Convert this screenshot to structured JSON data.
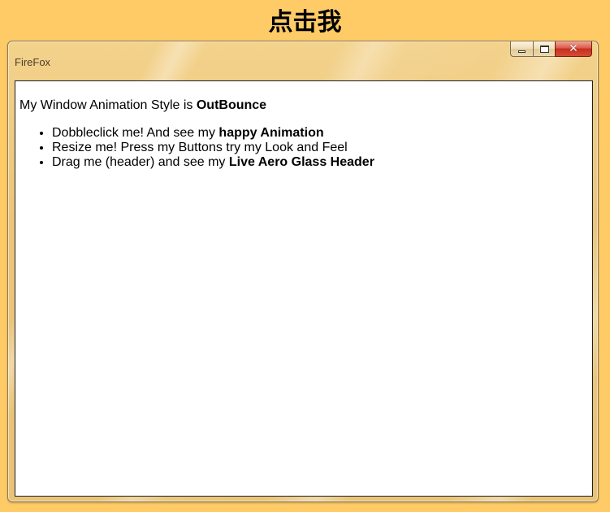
{
  "page": {
    "heading": "点击我"
  },
  "window": {
    "title": "FireFox",
    "controls": {
      "minimize": "minimize-icon",
      "maximize": "maximize-icon",
      "close": "close-icon"
    }
  },
  "content": {
    "intro_prefix": "My Window Animation Style is ",
    "intro_value": "OutBounce",
    "tips": [
      {
        "text": "Dobbleclick me! And see my ",
        "bold": "happy Animation"
      },
      {
        "text": "Resize me! Press my Buttons try my Look and Feel",
        "bold": ""
      },
      {
        "text": "Drag me (header) and see my ",
        "bold": "Live Aero Glass Header"
      }
    ]
  },
  "colors": {
    "background": "#fecb66",
    "window_frame": "#eac57a",
    "close_button": "#c5301e",
    "content_background": "#ffffff"
  }
}
